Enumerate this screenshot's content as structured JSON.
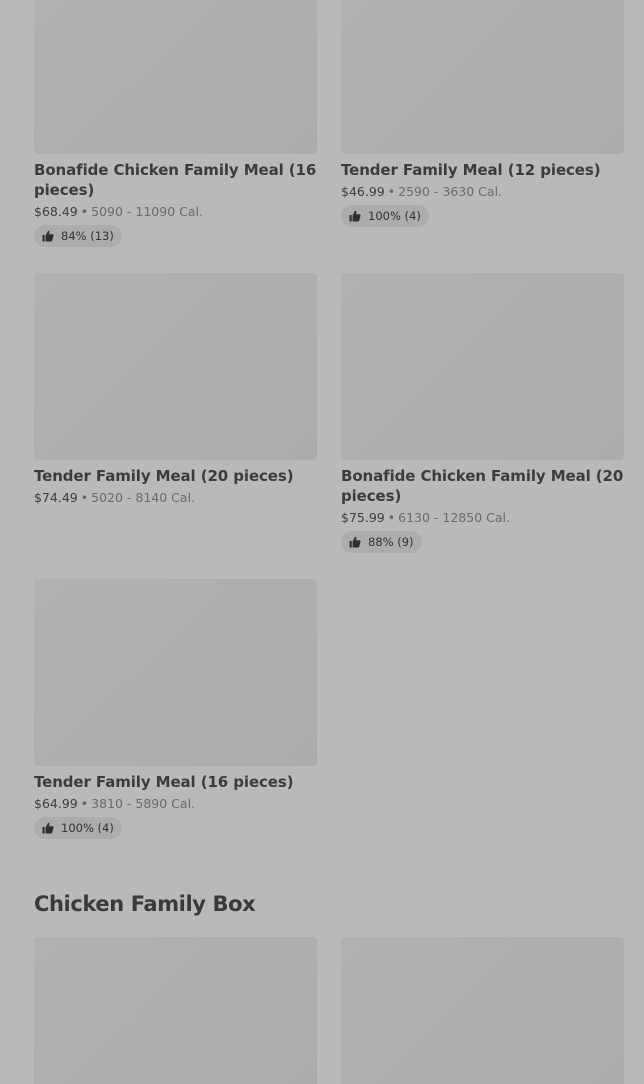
{
  "items": [
    {
      "title": "Bonafide Chicken Family Meal (16 pieces)",
      "price": "$68.49",
      "calories": "5090 - 11090 Cal.",
      "rating": "84% (13)"
    },
    {
      "title": "Tender Family Meal (12 pieces)",
      "price": "$46.99",
      "calories": "2590 - 3630 Cal.",
      "rating": "100% (4)"
    },
    {
      "title": "Tender Family Meal (20 pieces)",
      "price": "$74.49",
      "calories": "5020 - 8140 Cal."
    },
    {
      "title": "Bonafide Chicken Family Meal (20 pieces)",
      "price": "$75.99",
      "calories": "6130 - 12850 Cal.",
      "rating": "88% (9)"
    },
    {
      "title": "Tender Family Meal (16 pieces)",
      "price": "$64.99",
      "calories": "3810 - 5890 Cal.",
      "rating": "100% (4)"
    }
  ],
  "separator": "•",
  "section": {
    "title": "Chicken Family Box"
  },
  "icons": {
    "rating": "thumbs-up-icon"
  }
}
